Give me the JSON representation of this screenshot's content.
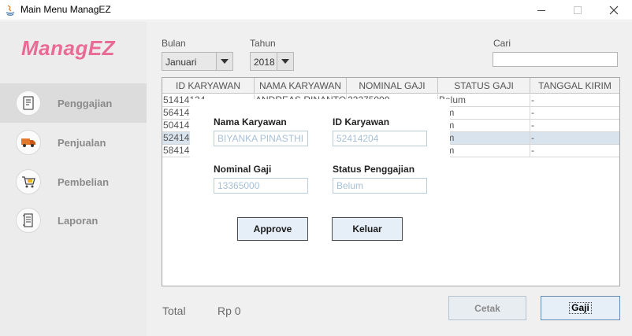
{
  "window": {
    "title": "Main Menu ManagEZ"
  },
  "sidebar": {
    "logo": "ManagEZ",
    "items": [
      {
        "label": "Penggajian",
        "icon": "receipt-icon",
        "active": true
      },
      {
        "label": "Penjualan",
        "icon": "delivery-truck-icon",
        "active": false
      },
      {
        "label": "Pembelian",
        "icon": "shopping-cart-icon",
        "active": false
      },
      {
        "label": "Laporan",
        "icon": "report-icon",
        "active": false
      }
    ]
  },
  "filters": {
    "bulan_label": "Bulan",
    "bulan_value": "Januari",
    "tahun_label": "Tahun",
    "tahun_value": "2018",
    "cari_label": "Cari",
    "cari_value": ""
  },
  "table": {
    "columns": [
      "ID KARYAWAN",
      "NAMA KARYAWAN",
      "NOMINAL GAJI",
      "STATUS GAJI",
      "TANGGAL KIRIM"
    ],
    "rows": [
      {
        "id": "51414134",
        "nama": "ANDREAS RINANTO",
        "nominal": "22275000",
        "status": "Belum",
        "tanggal": "-"
      },
      {
        "id": "56414",
        "nama": "",
        "nominal": "",
        "status": "lum",
        "tanggal": "-"
      },
      {
        "id": "50414",
        "nama": "",
        "nominal": "",
        "status": "lum",
        "tanggal": "-"
      },
      {
        "id": "52414",
        "nama": "",
        "nominal": "",
        "status": "lum",
        "tanggal": "-",
        "selected": true
      },
      {
        "id": "58414",
        "nama": "",
        "nominal": "",
        "status": "lum",
        "tanggal": "-"
      }
    ]
  },
  "footer": {
    "total_label": "Total",
    "total_value": "Rp 0",
    "cetak_label": "Cetak",
    "gaji_label": "Gaji"
  },
  "dialog": {
    "nama_label": "Nama Karyawan",
    "nama_value": "BIYANKA PINASTHI",
    "id_label": "ID Karyawan",
    "id_value": "52414204",
    "nominal_label": "Nominal Gaji",
    "nominal_value": "13365000",
    "status_label": "Status Penggajian",
    "status_value": "Belum",
    "approve_label": "Approve",
    "keluar_label": "Keluar"
  },
  "colors": {
    "brand": "#ea6a96",
    "selected_row": "#d8e3ee",
    "sidebar_bg": "#ececec",
    "main_bg": "#f0f0f0"
  }
}
